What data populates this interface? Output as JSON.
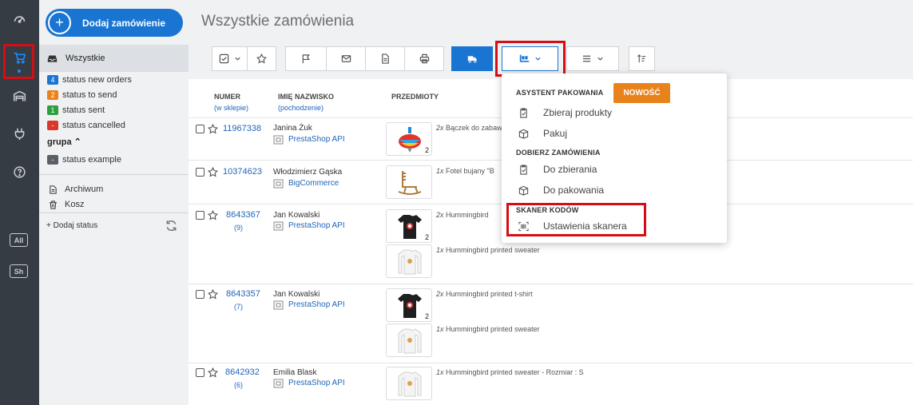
{
  "rail": {
    "items": [
      "dashboard-icon",
      "cart-icon",
      "warehouse-icon",
      "plug-icon",
      "help-icon"
    ],
    "badges": [
      "All",
      "Sh"
    ]
  },
  "sidebar": {
    "add_order_label": "Dodaj zamówienie",
    "all_label": "Wszystkie",
    "statuses": [
      {
        "count": "4",
        "label": "status new orders",
        "color": "#1a75d2"
      },
      {
        "count": "2",
        "label": "status to send",
        "color": "#e8831c"
      },
      {
        "count": "1",
        "label": "status sent",
        "color": "#2e9e3e"
      },
      {
        "count": "-",
        "label": "status cancelled",
        "color": "#d9392b"
      }
    ],
    "group_label": "grupa",
    "group_statuses": [
      {
        "count": "-",
        "label": "status example",
        "color": "#5a6068"
      }
    ],
    "archive_label": "Archiwum",
    "trash_label": "Kosz",
    "add_status_label": "+ Dodaj status"
  },
  "header": {
    "title": "Wszystkie zamówienia"
  },
  "toolbar": {
    "buttons": [
      "checkbox-select",
      "star",
      "flag",
      "mail",
      "document",
      "print",
      "truck",
      "packing",
      "menu",
      "sort"
    ]
  },
  "table": {
    "headers": {
      "number": "NUMER",
      "number_sub": "(w sklepie)",
      "name": "IMIĘ NAZWISKO",
      "name_sub": "(pochodzenie)",
      "items": "PRZEDMIOTY"
    },
    "rows": [
      {
        "number": "11967338",
        "shop_number": "",
        "name": "Janina Żuk",
        "source": "PrestaShop API",
        "items": [
          {
            "qty_text": "2x",
            "name": "Bączek do zabawy",
            "thumb_qty": "2",
            "thumb": "spinning-top"
          }
        ]
      },
      {
        "number": "10374623",
        "shop_number": "",
        "name": "Włodzimierz Gąska",
        "source": "BigCommerce",
        "items": [
          {
            "qty_text": "1x",
            "name": "Fotel bujany \"B",
            "thumb_qty": "",
            "thumb": "rocking-chair"
          }
        ]
      },
      {
        "number": "8643367",
        "shop_number": "(9)",
        "name": "Jan Kowalski",
        "source": "PrestaShop API",
        "items": [
          {
            "qty_text": "2x",
            "name": "Hummingbird",
            "thumb_qty": "2",
            "thumb": "black-tshirt"
          },
          {
            "qty_text": "1x",
            "name": "Hummingbird printed sweater",
            "thumb_qty": "",
            "thumb": "white-sweater"
          }
        ]
      },
      {
        "number": "8643357",
        "shop_number": "(7)",
        "name": "Jan Kowalski",
        "source": "PrestaShop API",
        "items": [
          {
            "qty_text": "2x",
            "name": "Hummingbird printed t-shirt",
            "thumb_qty": "2",
            "thumb": "black-tshirt"
          },
          {
            "qty_text": "1x",
            "name": "Hummingbird printed sweater",
            "thumb_qty": "",
            "thumb": "white-sweater"
          }
        ]
      },
      {
        "number": "8642932",
        "shop_number": "(6)",
        "name": "Emilia Blask",
        "source": "PrestaShop API",
        "items": [
          {
            "qty_text": "1x",
            "name": "Hummingbird printed sweater - Rozmiar : S",
            "thumb_qty": "",
            "thumb": "white-sweater"
          }
        ]
      }
    ]
  },
  "dropdown": {
    "section1": "ASYSTENT PAKOWANIA",
    "new_badge": "NOWOŚĆ",
    "item_collect": "Zbieraj produkty",
    "item_pack": "Pakuj",
    "section2": "DOBIERZ ZAMÓWIENIA",
    "item_to_collect": "Do zbierania",
    "item_to_pack": "Do pakowania",
    "section3": "SKANER KODÓW",
    "item_scanner": "Ustawienia skanera"
  },
  "colors": {
    "accent": "#1a75d2",
    "highlight": "#d40e14",
    "rail": "#353c44",
    "new_badge": "#e8831c"
  }
}
